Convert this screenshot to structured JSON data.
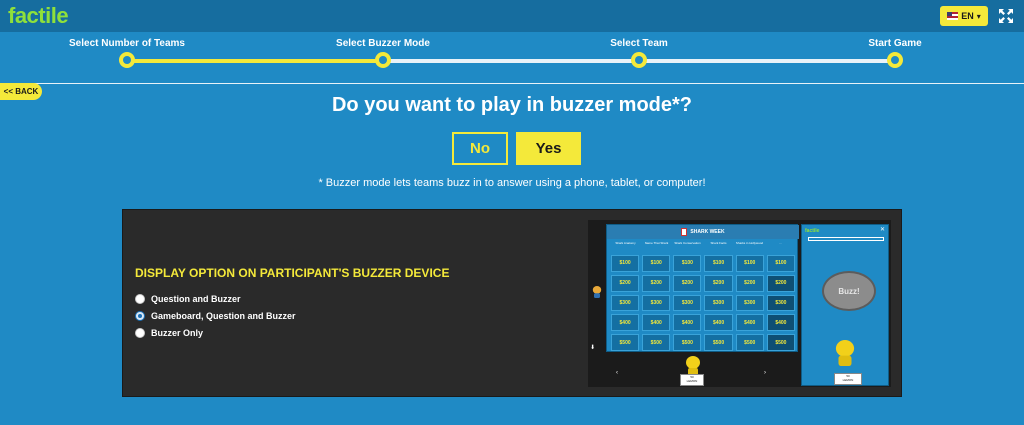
{
  "app": {
    "logo": "factile"
  },
  "header": {
    "language": "EN",
    "language_icon": "us-flag-icon",
    "fullscreen_icon": "fullscreen-icon"
  },
  "steps": [
    {
      "label": "Select Number of Teams",
      "completed": true
    },
    {
      "label": "Select Buzzer Mode",
      "completed": true
    },
    {
      "label": "Select Team",
      "completed": false
    },
    {
      "label": "Start Game",
      "completed": false
    }
  ],
  "back_label": "<< BACK",
  "question": "Do you want to play in buzzer mode*?",
  "buttons": {
    "no": "No",
    "yes": "Yes"
  },
  "note": "* Buzzer mode lets teams buzz in to answer using a phone, tablet, or computer!",
  "display_option": {
    "title": "DISPLAY OPTION ON PARTICIPANT'S BUZZER DEVICE",
    "options": [
      {
        "label": "Question and Buzzer",
        "selected": false
      },
      {
        "label": "Gameboard, Question and Buzzer",
        "selected": true
      },
      {
        "label": "Buzzer Only",
        "selected": false
      }
    ]
  },
  "preview": {
    "board_title": "SHARK WEEK",
    "categories": [
      "Shark Anatomy",
      "Name That Shark",
      "Shark Conservation",
      "Shark Facts",
      "Sharks in Hollywood",
      "..."
    ],
    "values": [
      "$100",
      "$200",
      "$300",
      "$400",
      "$500"
    ],
    "buzzer_logo": "factile",
    "buzz_label": "Buzz!",
    "team_score": "50",
    "team_name": "LEMON"
  },
  "colors": {
    "background": "#1f8ac5",
    "accent": "#f4e93a",
    "logo": "#8fe03b",
    "panel": "#2a2a2a"
  }
}
